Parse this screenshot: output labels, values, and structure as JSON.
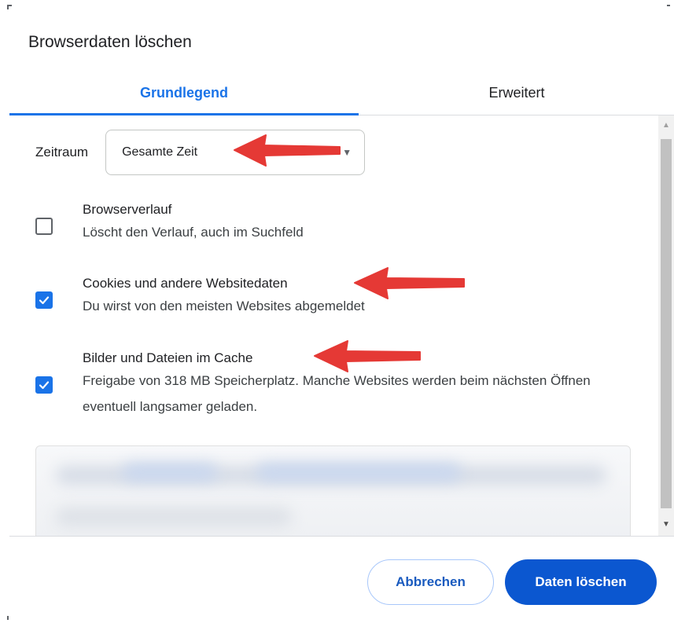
{
  "dialog": {
    "title": "Browserdaten löschen"
  },
  "tabs": [
    {
      "label": "Grundlegend",
      "active": true
    },
    {
      "label": "Erweitert",
      "active": false
    }
  ],
  "time_range": {
    "label": "Zeitraum",
    "selected": "Gesamte Zeit"
  },
  "options": [
    {
      "title": "Browserverlauf",
      "description": "Löscht den Verlauf, auch im Suchfeld",
      "checked": false
    },
    {
      "title": "Cookies und andere Websitedaten",
      "description": "Du wirst von den meisten Websites abgemeldet",
      "checked": true
    },
    {
      "title": "Bilder und Dateien im Cache",
      "description": "Freigabe von 318 MB Speicherplatz. Manche Websites werden beim nächsten Öffnen eventuell langsamer geladen.",
      "checked": true
    }
  ],
  "buttons": {
    "cancel": "Abbrechen",
    "confirm": "Daten löschen"
  },
  "colors": {
    "accent": "#1a73e8",
    "primary_button": "#0b57d0",
    "annotation_arrow": "#e53935"
  },
  "icons": {
    "dropdown": "chevron-down-icon",
    "checkmark": "check-icon",
    "annotation": "red-arrow-icon"
  }
}
